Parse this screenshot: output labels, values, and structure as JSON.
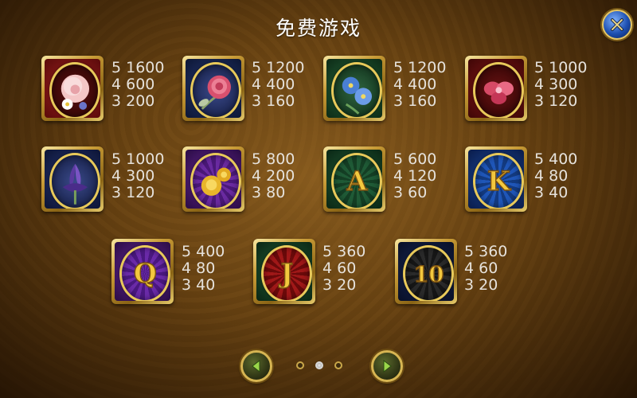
{
  "title": "免费游戏",
  "symbols": [
    {
      "name": "white-peony",
      "pays": [
        "5 1600",
        "4 600",
        "3 200"
      ],
      "frame": "#8b1a1a"
    },
    {
      "name": "pink-rose",
      "pays": [
        "5 1200",
        "4 400",
        "3 160"
      ],
      "frame": "#14244f"
    },
    {
      "name": "blue-flowers",
      "pays": [
        "5 1200",
        "4 400",
        "3 160"
      ],
      "frame": "#1a4a2a"
    },
    {
      "name": "red-orchid",
      "pays": [
        "5 1000",
        "4 300",
        "3 120"
      ],
      "frame": "#7a1212"
    },
    {
      "name": "purple-iris",
      "pays": [
        "5 1000",
        "4 300",
        "3 120"
      ],
      "frame": "#1c2550"
    },
    {
      "name": "yellow-roses",
      "pays": [
        "5 800",
        "4 200",
        "3 80"
      ],
      "frame": "#3e1655"
    },
    {
      "name": "letter-a",
      "letter": "A",
      "pays": [
        "5 600",
        "4 120",
        "3 60"
      ],
      "frame": "#134226"
    },
    {
      "name": "letter-k",
      "letter": "K",
      "pays": [
        "5 400",
        "4 80",
        "3 40"
      ],
      "frame": "#0f2f6a"
    },
    {
      "name": "letter-q",
      "letter": "Q",
      "pays": [
        "5 400",
        "4 80",
        "3 40"
      ],
      "frame": "#4a1a78"
    },
    {
      "name": "letter-j",
      "letter": "J",
      "pays": [
        "5 360",
        "4 60",
        "3 20"
      ],
      "frame": "#7a1010"
    },
    {
      "name": "number-10",
      "letter": "10",
      "pays": [
        "5 360",
        "4 60",
        "3 20"
      ],
      "frame": "#0b1f4e"
    }
  ],
  "pagination": {
    "pages": 3,
    "current": 2
  },
  "colors": {
    "text": "#e6e2dc",
    "gold": "#e8c95a"
  }
}
